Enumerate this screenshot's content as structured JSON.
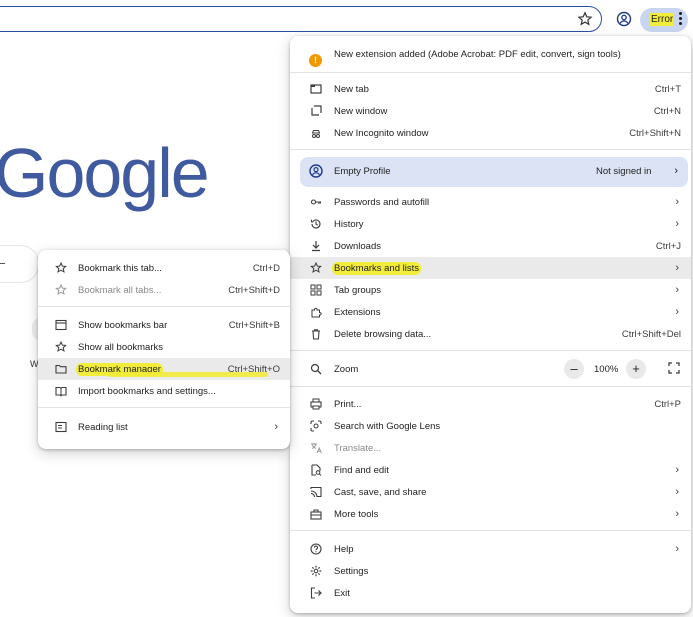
{
  "toolbar": {
    "error_label": "Error"
  },
  "page": {
    "logo_text": "Google",
    "shortcut_letter": "W"
  },
  "main_menu": {
    "notice": "New extension added (Adobe Acrobat: PDF edit, convert, sign tools)",
    "new_tab": {
      "label": "New tab",
      "shortcut": "Ctrl+T"
    },
    "new_window": {
      "label": "New window",
      "shortcut": "Ctrl+N"
    },
    "incognito": {
      "label": "New Incognito window",
      "shortcut": "Ctrl+Shift+N"
    },
    "profile": {
      "label": "Empty Profile",
      "status": "Not signed in"
    },
    "passwords": {
      "label": "Passwords and autofill"
    },
    "history": {
      "label": "History"
    },
    "downloads": {
      "label": "Downloads",
      "shortcut": "Ctrl+J"
    },
    "bookmarks": {
      "label": "Bookmarks and lists"
    },
    "tab_groups": {
      "label": "Tab groups"
    },
    "extensions": {
      "label": "Extensions"
    },
    "delete_data": {
      "label": "Delete browsing data...",
      "shortcut": "Ctrl+Shift+Del"
    },
    "zoom": {
      "label": "Zoom",
      "value": "100%",
      "minus": "–",
      "plus": "+"
    },
    "print": {
      "label": "Print...",
      "shortcut": "Ctrl+P"
    },
    "lens": {
      "label": "Search with Google Lens"
    },
    "translate": {
      "label": "Translate..."
    },
    "find_edit": {
      "label": "Find and edit"
    },
    "cast_save": {
      "label": "Cast, save, and share"
    },
    "more_tools": {
      "label": "More tools"
    },
    "help": {
      "label": "Help"
    },
    "settings": {
      "label": "Settings"
    },
    "exit": {
      "label": "Exit"
    }
  },
  "bookmarks_menu": {
    "bookmark_tab": {
      "label": "Bookmark this tab...",
      "shortcut": "Ctrl+D"
    },
    "bookmark_all": {
      "label": "Bookmark all tabs...",
      "shortcut": "Ctrl+Shift+D"
    },
    "show_bar": {
      "label": "Show bookmarks bar",
      "shortcut": "Ctrl+Shift+B"
    },
    "show_all": {
      "label": "Show all bookmarks"
    },
    "manager": {
      "label": "Bookmark manager",
      "shortcut": "Ctrl+Shift+O"
    },
    "import": {
      "label": "Import bookmarks and settings..."
    },
    "reading_list": {
      "label": "Reading list"
    }
  },
  "colors": {
    "accent": "#3f5a9e",
    "highlight": "#f2ec3a",
    "profile_bg": "#dbe3f5",
    "notice": "#f29900"
  }
}
